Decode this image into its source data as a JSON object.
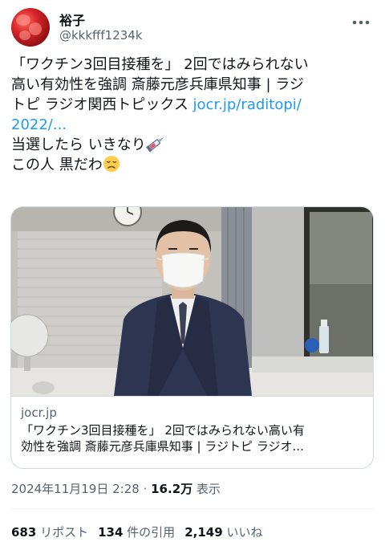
{
  "user": {
    "name": "裕子",
    "handle": "@kkkfff1234k"
  },
  "tweet": {
    "line1": "「ワクチン3回目接種を」 2回ではみられない",
    "line2": "高い有効性を強調 斎藤元彦兵庫県知事 | ラジ",
    "line3a": "トピ ラジオ関西トピックス ",
    "link_part1": "jocr.jp/raditopi/",
    "link_part2": "2022/...",
    "line5": "当選したら いきなり",
    "line6": "この人 黒だわ",
    "emoji1": "syringe-icon",
    "emoji2": "disappointed-face-icon"
  },
  "card": {
    "domain": "jocr.jp",
    "title_line1": "「ワクチン3回目接種を」 2回ではみられない高い有",
    "title_line2": "効性を強調 斎藤元彦兵庫県知事 | ラジトピ ラジオ..."
  },
  "meta": {
    "timestamp": "2024年11月19日 2:28",
    "separator": " · ",
    "views": "16.2万",
    "views_label": " 表示"
  },
  "stats": {
    "reposts": "683",
    "reposts_label": " リポスト",
    "quotes": "134",
    "quotes_label": " 件の引用",
    "likes": "2,149",
    "likes_label": " いいね"
  },
  "colors": {
    "link": "#1d9bf0",
    "secondary_text": "#536471",
    "primary_text": "#0f1419",
    "border": "#cfd9de"
  }
}
